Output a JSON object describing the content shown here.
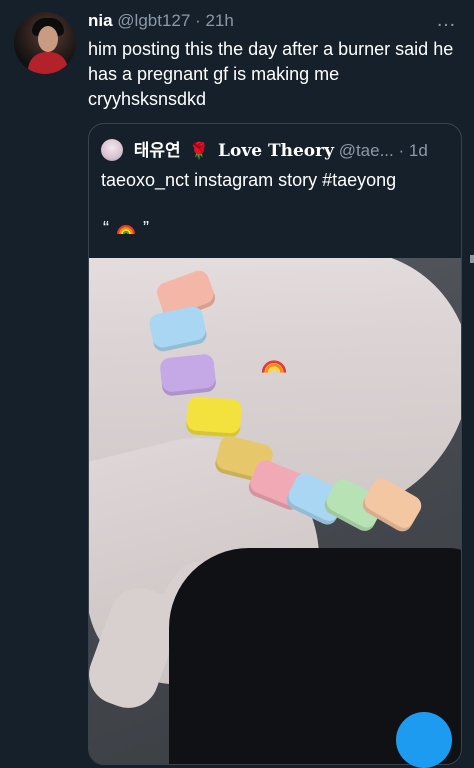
{
  "tweet": {
    "display_name": "nia",
    "handle": "@lgbt127",
    "separator": "·",
    "time": "21h",
    "text": "him posting this the day after a burner said he has a pregnant gf is making me cryyhsksnsdkd",
    "more_icon": "…"
  },
  "quoted_tweet": {
    "display_name_ko": "태유연",
    "rose_emoji": "🌹",
    "display_name_en": "Love Theory",
    "handle": "@tae...",
    "separator": "·",
    "time": "1d",
    "text": "taeoxo_nct instagram story #taeyong",
    "quote_open": "“",
    "quote_close": "”"
  },
  "colors": {
    "background": "#15202b",
    "secondary_text": "#8b98a5",
    "border": "#38444d",
    "accent": "#1d9bf0"
  }
}
